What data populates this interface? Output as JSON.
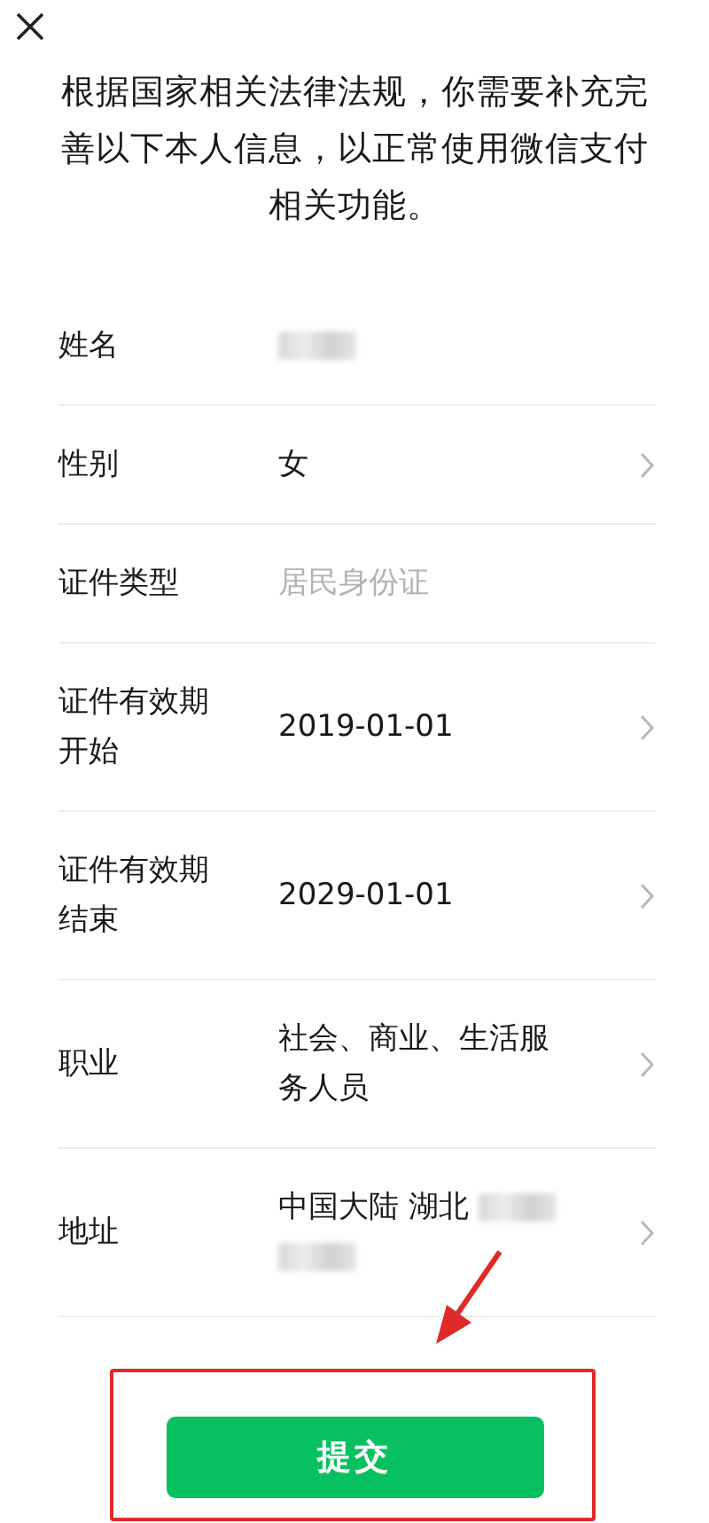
{
  "notice": "根据国家相关法律法规，你需要补充完善以下本人信息，以正常使用微信支付相关功能。",
  "rows": [
    {
      "label": "姓名",
      "value": "",
      "redacted": true,
      "muted": false,
      "chevron": false
    },
    {
      "label": "性别",
      "value": "女",
      "redacted": false,
      "muted": false,
      "chevron": true
    },
    {
      "label": "证件类型",
      "value": "居民身份证",
      "redacted": false,
      "muted": true,
      "chevron": false
    },
    {
      "label": "证件有效期开始",
      "value": "2019-01-01",
      "redacted": false,
      "muted": false,
      "chevron": true
    },
    {
      "label": "证件有效期结束",
      "value": "2029-01-01",
      "redacted": false,
      "muted": false,
      "chevron": true
    },
    {
      "label": "职业",
      "value": "社会、商业、生活服务人员",
      "redacted": false,
      "muted": false,
      "chevron": true
    },
    {
      "label": "地址",
      "value": "中国大陆 湖北",
      "redacted": true,
      "muted": false,
      "chevron": true
    }
  ],
  "submit": {
    "label": "提交"
  },
  "annotation": {
    "highlight": true
  }
}
